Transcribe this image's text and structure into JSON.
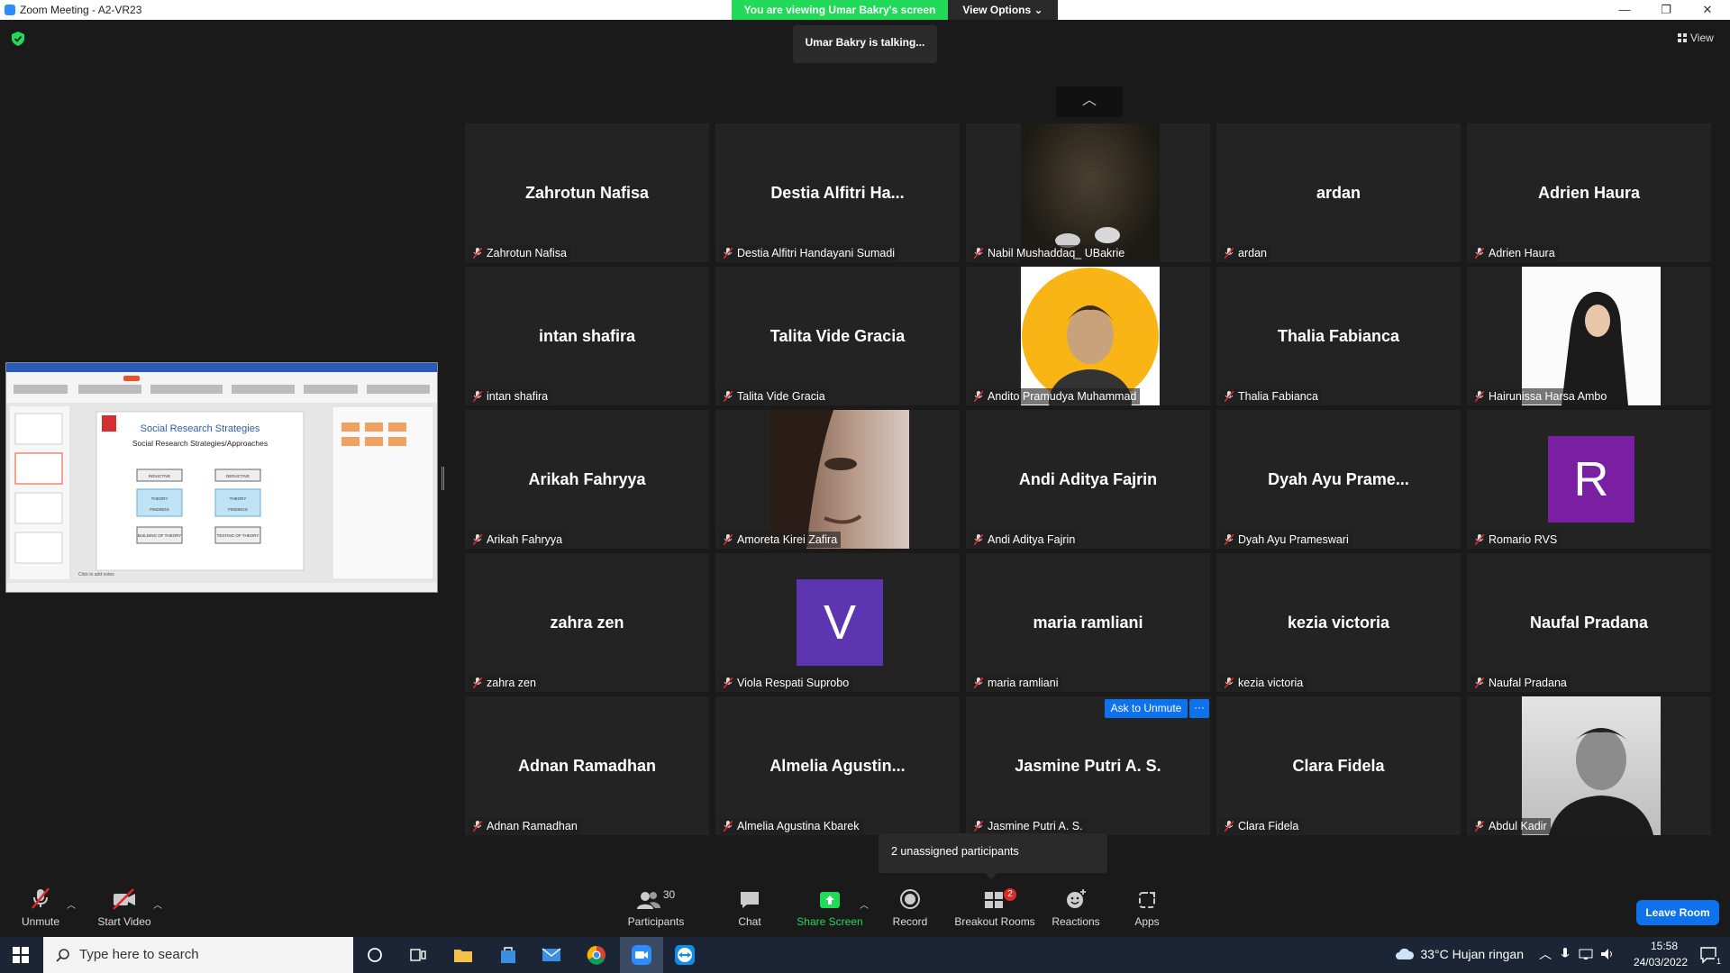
{
  "window": {
    "title": "Zoom Meeting - A2-VR23",
    "viewing_banner": "You are viewing Umar Bakry's screen",
    "view_options": "View Options",
    "talking": "Umar Bakry is talking...",
    "view_label": "View"
  },
  "shared_screen": {
    "slide_title": "Social Research Strategies",
    "slide_subtitle": "Social Research Strategies/Approaches",
    "boxes": [
      "INDUCTIVE",
      "DEDUCTIVE",
      "THEORY",
      "FINDINGS",
      "THEORY",
      "FINDINGS",
      "BUILDING OF THEORY",
      "TESTING OF THEORY"
    ],
    "notes_hint": "Click to add notes"
  },
  "participants": [
    {
      "display": "Zahrotun Nafisa",
      "label": "Zahrotun Nafisa",
      "type": "name"
    },
    {
      "display": "Destia  Alfitri  Ha...",
      "label": "Destia Alfitri Handayani Sumadi",
      "type": "name"
    },
    {
      "display": "",
      "label": "Nabil Mushaddaq_ UBakrie",
      "type": "video",
      "video": "dark-room"
    },
    {
      "display": "ardan",
      "label": "ardan",
      "type": "name"
    },
    {
      "display": "Adrien Haura",
      "label": "Adrien Haura",
      "type": "name"
    },
    {
      "display": "intan shafira",
      "label": "intan shafira",
      "type": "name"
    },
    {
      "display": "Talita Vide Gracia",
      "label": "Talita Vide Gracia",
      "type": "name"
    },
    {
      "display": "",
      "label": "Andito Pramudya Muhammad",
      "type": "video",
      "video": "yellow-avatar"
    },
    {
      "display": "Thalia Fabianca",
      "label": "Thalia Fabianca",
      "type": "name"
    },
    {
      "display": "",
      "label": "Hairunissa Harsa Ambo",
      "type": "video",
      "video": "hijab-photo"
    },
    {
      "display": "Arikah Fahryya",
      "label": "Arikah Fahryya",
      "type": "name"
    },
    {
      "display": "",
      "label": "Amoreta Kirei Zafira",
      "type": "video",
      "video": "face-closeup"
    },
    {
      "display": "Andi Aditya Fajrin",
      "label": "Andi Aditya Fajrin",
      "type": "name"
    },
    {
      "display": "Dyah Ayu Prame...",
      "label": "Dyah Ayu Prameswari",
      "type": "name"
    },
    {
      "display": "R",
      "label": "Romario RVS",
      "type": "avatar",
      "color": "#7b1fa2"
    },
    {
      "display": "zahra zen",
      "label": "zahra zen",
      "type": "name"
    },
    {
      "display": "V",
      "label": "Viola Respati Suprobo",
      "type": "avatar",
      "color": "#5e35b1"
    },
    {
      "display": "maria ramliani",
      "label": "maria ramliani",
      "type": "name"
    },
    {
      "display": "kezia victoria",
      "label": "kezia victoria",
      "type": "name"
    },
    {
      "display": "Naufal Pradana",
      "label": "Naufal Pradana",
      "type": "name"
    },
    {
      "display": "Adnan Ramadhan",
      "label": "Adnan Ramadhan",
      "type": "name"
    },
    {
      "display": "Almelia  Agustin...",
      "label": "Almelia Agustina Kbarek",
      "type": "name"
    },
    {
      "display": "Jasmine Putri A. S.",
      "label": "Jasmine Putri A. S.",
      "type": "name"
    },
    {
      "display": "Clara Fidela",
      "label": "Clara Fidela",
      "type": "name"
    },
    {
      "display": "",
      "label": "Abdul Kadir",
      "type": "video",
      "video": "bw-face"
    }
  ],
  "tile_menu": {
    "ask_unmute": "Ask to Unmute",
    "more": "···"
  },
  "unassigned": "2 unassigned participants",
  "controls": {
    "unmute": "Unmute",
    "start_video": "Start Video",
    "participants": "Participants",
    "participants_count": "30",
    "chat": "Chat",
    "share_screen": "Share Screen",
    "record": "Record",
    "breakout_rooms": "Breakout Rooms",
    "breakout_badge": "2",
    "reactions": "Reactions",
    "apps": "Apps",
    "leave": "Leave Room"
  },
  "taskbar": {
    "search_placeholder": "Type here to search",
    "weather": "33°C  Hujan ringan",
    "time": "15:58",
    "date": "24/03/2022",
    "notif_count": "1"
  },
  "colors": {
    "accent": "#0e72ed",
    "banner": "#23d959",
    "mute": "#e02828"
  }
}
